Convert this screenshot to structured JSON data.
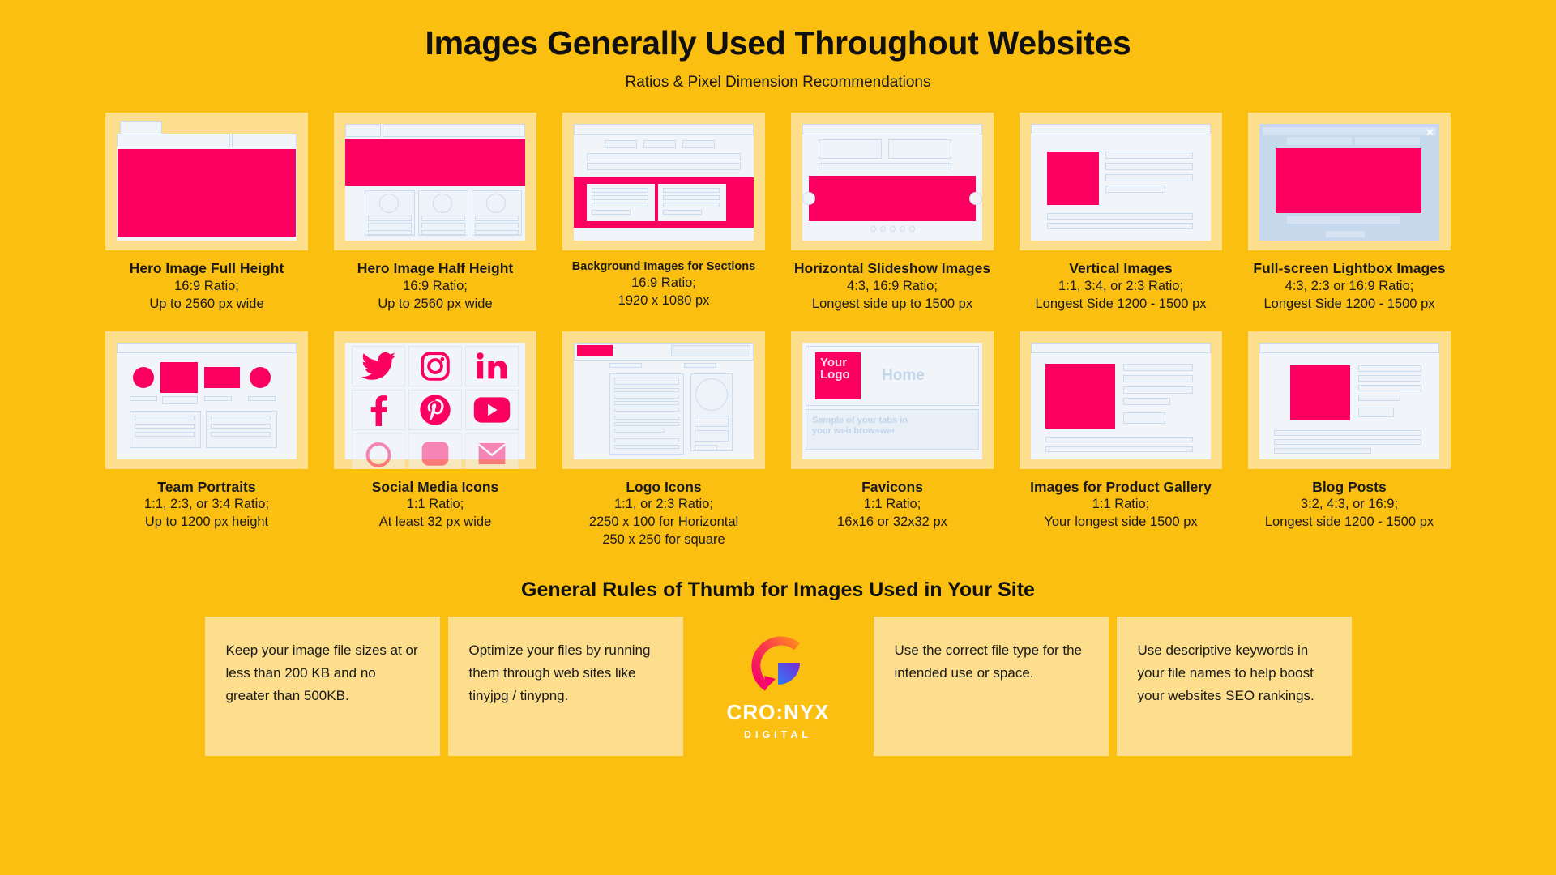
{
  "header": {
    "title": "Images Generally Used Throughout Websites",
    "subtitle": "Ratios & Pixel Dimension Recommendations"
  },
  "colors": {
    "background": "#FBBF11",
    "card": "#FCDE8C",
    "accent_pink": "#FB0061",
    "wire_blue": "#CBDCEF",
    "wire_fill": "#F1F5FA",
    "text": "#101010"
  },
  "cards": [
    {
      "id": "hero-full-height",
      "title": "Hero Image Full Height",
      "line1": "16:9 Ratio;",
      "line2": "Up to 2560 px wide",
      "line3": ""
    },
    {
      "id": "hero-half-height",
      "title": "Hero Image Half Height",
      "line1": "16:9 Ratio;",
      "line2": "Up to 2560 px wide",
      "line3": ""
    },
    {
      "id": "background-sections",
      "title": "Background Images for Sections",
      "line1": "16:9 Ratio;",
      "line2": "1920 x 1080 px",
      "line3": ""
    },
    {
      "id": "horizontal-slideshow",
      "title": "Horizontal Slideshow Images",
      "line1": "4:3, 16:9 Ratio;",
      "line2": "Longest side up to 1500 px",
      "line3": ""
    },
    {
      "id": "vertical-images",
      "title": "Vertical Images",
      "line1": "1:1, 3:4, or 2:3 Ratio;",
      "line2": "Longest Side 1200 - 1500 px",
      "line3": ""
    },
    {
      "id": "fullscreen-lightbox",
      "title": "Full-screen Lightbox Images",
      "line1": "4:3, 2:3 or 16:9 Ratio;",
      "line2": "Longest Side 1200 - 1500 px",
      "line3": ""
    },
    {
      "id": "team-portraits",
      "title": "Team Portraits",
      "line1": "1:1, 2:3, or 3:4 Ratio;",
      "line2": "Up to 1200 px height",
      "line3": ""
    },
    {
      "id": "social-media-icons",
      "title": "Social Media Icons",
      "line1": "1:1 Ratio;",
      "line2": "At least 32 px wide",
      "line3": ""
    },
    {
      "id": "logo-icons",
      "title": "Logo Icons",
      "line1": "1:1, or 2:3 Ratio;",
      "line2": "2250 x 100 for Horizontal",
      "line3": "250 x 250 for square"
    },
    {
      "id": "favicons",
      "title": "Favicons",
      "line1": "1:1 Ratio;",
      "line2": "16x16 or 32x32 px",
      "line3": ""
    },
    {
      "id": "product-gallery",
      "title": "Images for Product Gallery",
      "line1": "1:1 Ratio;",
      "line2": "Your longest side 1500 px",
      "line3": ""
    },
    {
      "id": "blog-posts",
      "title": "Blog Posts",
      "line1": "3:2, 4:3, or 16:9;",
      "line2": "Longest side 1200 - 1500 px",
      "line3": ""
    }
  ],
  "favicon_mock": {
    "logo_line1": "Your",
    "logo_line2": "Logo",
    "home_label": "Home",
    "note_line1": "Sample of your tabs in",
    "note_line2": "your web browswer"
  },
  "lightbox_mock": {
    "close_glyph": "✕"
  },
  "social_icons": [
    "twitter-icon",
    "instagram-icon",
    "linkedin-icon",
    "facebook-icon",
    "pinterest-icon",
    "youtube-icon"
  ],
  "rules": {
    "title": "General Rules of Thumb for Images Used in Your Site",
    "items": [
      "Keep your image file sizes at or less than 200 KB and no greater than 500KB.",
      "Optimize your files by running them through web sites like tinyjpg / tinypng.",
      "Use the correct file type for the intended use or space.",
      "Use descriptive keywords in your file names to help boost your websites SEO rankings."
    ]
  },
  "logo": {
    "name": "CRO:NYX",
    "tagline": "DIGITAL"
  }
}
